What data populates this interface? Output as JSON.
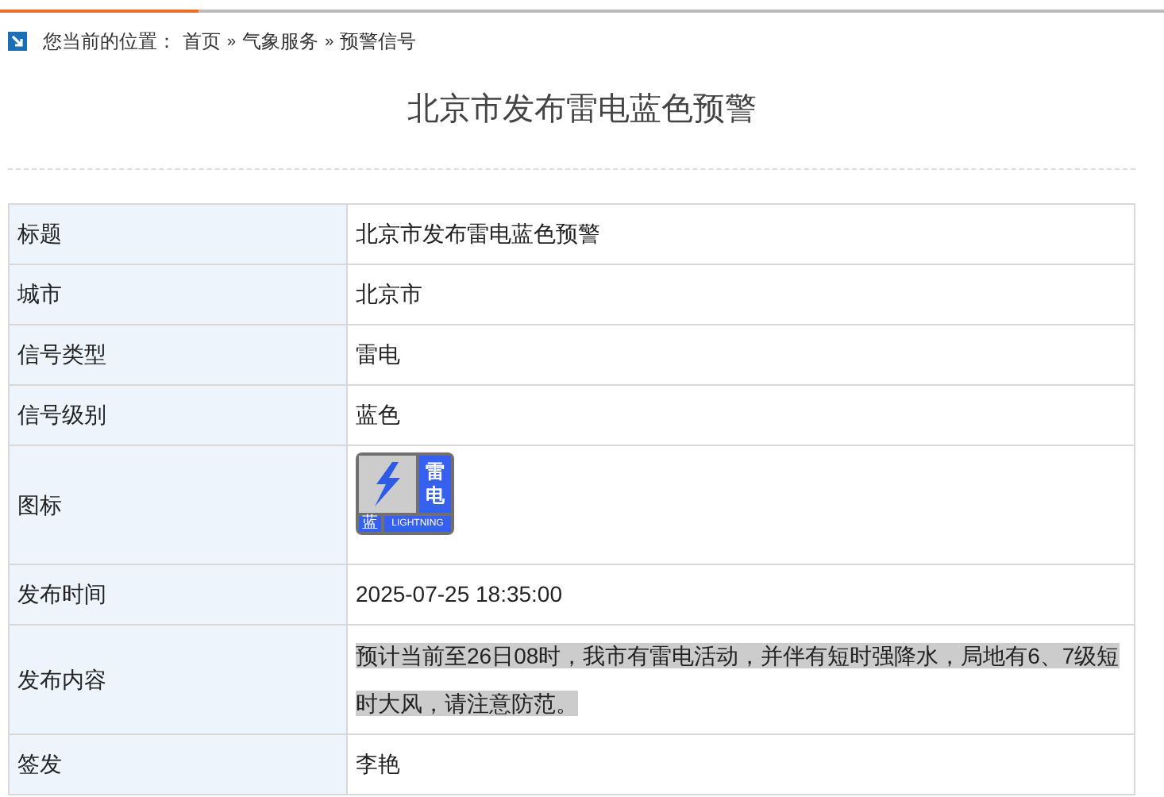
{
  "breadcrumb": {
    "label": "您当前的位置：",
    "items": [
      "首页",
      "气象服务",
      "预警信号"
    ],
    "separator": "»"
  },
  "title": "北京市发布雷电蓝色预警",
  "rows": [
    {
      "label": "标题",
      "kind": "text",
      "value": "北京市发布雷电蓝色预警"
    },
    {
      "label": "城市",
      "kind": "text",
      "value": "北京市"
    },
    {
      "label": "信号类型",
      "kind": "text",
      "value": "雷电"
    },
    {
      "label": "信号级别",
      "kind": "text",
      "value": "蓝色"
    },
    {
      "label": "图标",
      "kind": "icon",
      "icon": {
        "top_char": "雷",
        "bottom_char": "电",
        "level_char": "蓝",
        "caption": "LIGHTNING"
      }
    },
    {
      "label": "发布时间",
      "kind": "text",
      "value": "2025-07-25 18:35:00"
    },
    {
      "label": "发布内容",
      "kind": "text",
      "value": "预计当前至26日08时，我市有雷电活动，并伴有短时强降水，局地有6、7级短时大风，请注意防范。",
      "highlighted": true
    },
    {
      "label": "签发",
      "kind": "text",
      "value": "李艳"
    }
  ]
}
